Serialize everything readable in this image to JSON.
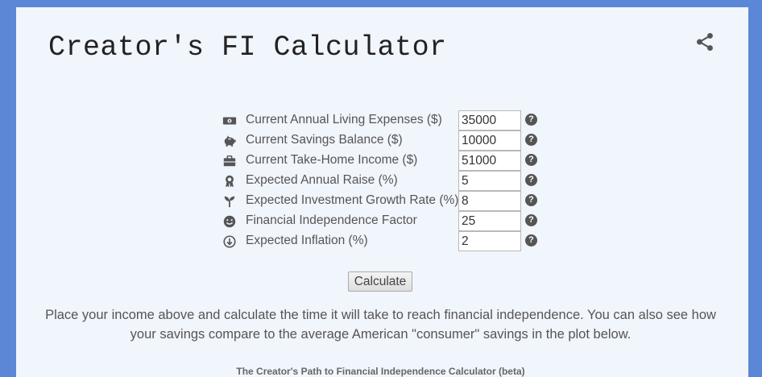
{
  "header": {
    "title": "Creator's FI Calculator",
    "share_icon": "share-icon"
  },
  "form": {
    "fields": [
      {
        "label": "Current Annual Living Expenses ($)",
        "value": "35000",
        "icon": "money-bill-icon"
      },
      {
        "label": "Current Savings Balance ($)",
        "value": "10000",
        "icon": "piggy-bank-icon"
      },
      {
        "label": "Current Take-Home Income ($)",
        "value": "51000",
        "icon": "briefcase-icon"
      },
      {
        "label": "Expected Annual Raise (%)",
        "value": "5",
        "icon": "award-icon"
      },
      {
        "label": "Expected Investment Growth Rate (%)",
        "value": "8",
        "icon": "seedling-icon"
      },
      {
        "label": "Financial Independence Factor",
        "value": "25",
        "icon": "smile-icon"
      },
      {
        "label": "Expected Inflation (%)",
        "value": "2",
        "icon": "arrow-circle-down-icon"
      }
    ],
    "help_glyph": "?"
  },
  "actions": {
    "calculate_label": "Calculate"
  },
  "description": "Place your income above and calculate the time it will take to reach financial independence. You can also see how your savings compare to the average American \"consumer\" savings in the plot below.",
  "plot": {
    "title": "The Creator's Path to Financial Independence Calculator (beta)"
  },
  "colors": {
    "frame": "#5b87d6",
    "card": "#f1f5fc",
    "icon": "#555555"
  }
}
